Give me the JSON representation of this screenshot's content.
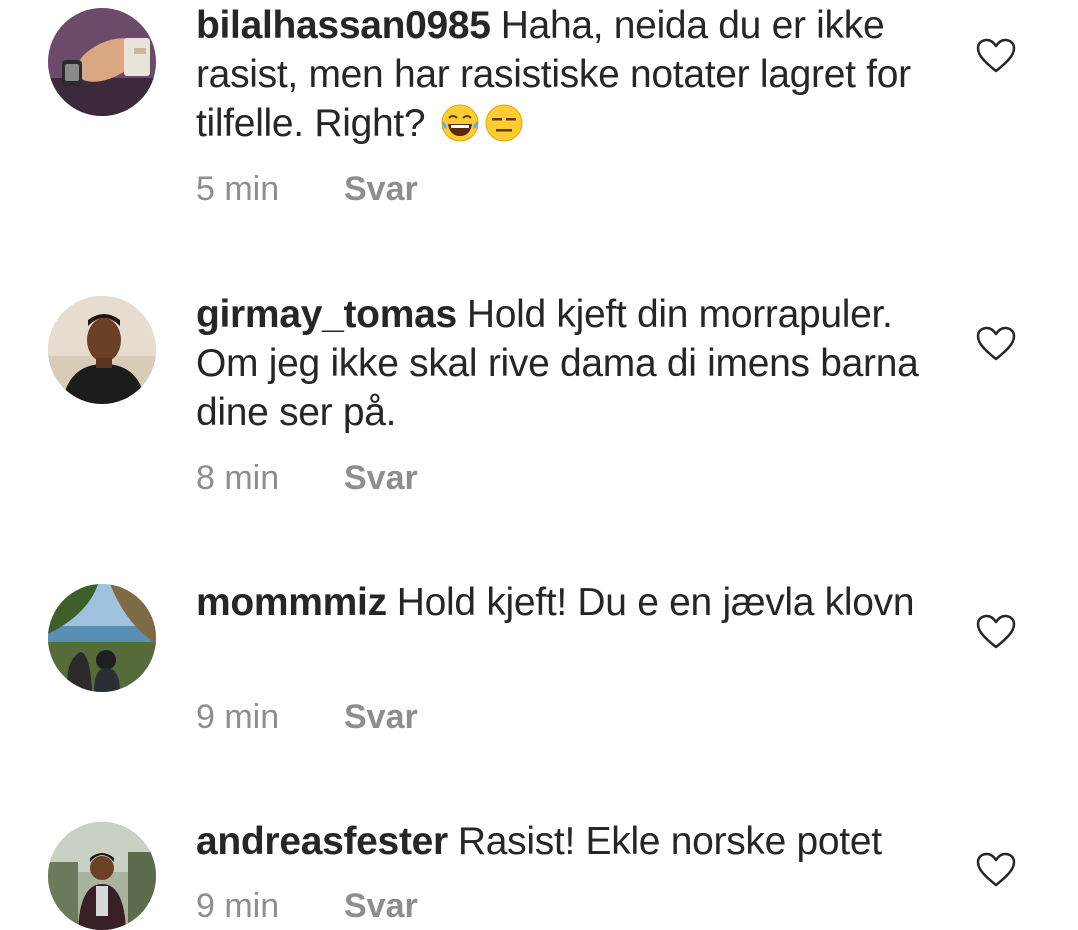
{
  "comments": [
    {
      "username": "bilalhassan0985",
      "text": "Haha, neida du er ikke rasist, men har rasistiske notater lagret for tilfelle. Right?",
      "emojis": [
        "😂",
        "😑"
      ],
      "time": "5 min",
      "reply_label": "Svar"
    },
    {
      "username": "girmay_tomas",
      "text": "Hold kjeft din morrapuler. Om jeg ikke skal rive dama di imens barna dine ser på.",
      "time": "8 min",
      "reply_label": "Svar"
    },
    {
      "username": "mommmiz",
      "text": "Hold kjeft! Du e en jævla klovn",
      "time": "9 min",
      "reply_label": "Svar"
    },
    {
      "username": "andreasfester",
      "text": "Rasist! Ekle norske potet",
      "time": "9 min",
      "reply_label": "Svar"
    }
  ],
  "icons": {
    "like": "heart-outline-icon"
  },
  "colors": {
    "text": "#262626",
    "secondary": "#8e8e8e"
  }
}
